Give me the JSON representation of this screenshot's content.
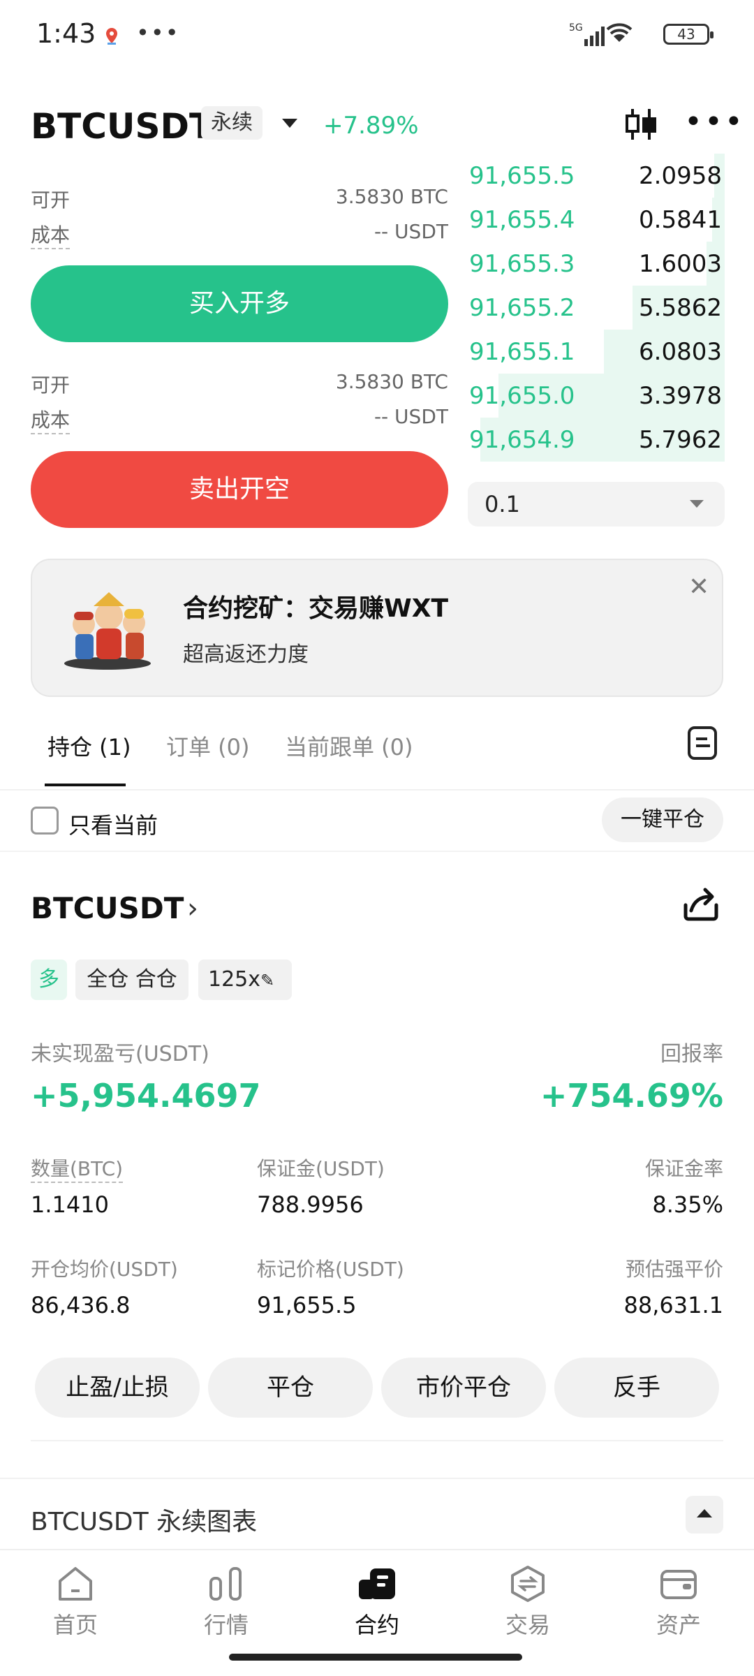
{
  "status_bar": {
    "time": "1:43",
    "network": "5G",
    "battery": "43"
  },
  "header": {
    "pair": "BTCUSDT",
    "contract_type": "永续",
    "change": "+7.89%"
  },
  "order_panel": {
    "buy_section": {
      "available_label": "可开",
      "available_value": "3.5830 BTC",
      "cost_label": "成本",
      "cost_value": "-- USDT",
      "button": "买入开多"
    },
    "sell_section": {
      "available_label": "可开",
      "available_value": "3.5830 BTC",
      "cost_label": "成本",
      "cost_value": "-- USDT",
      "button": "卖出开空"
    }
  },
  "order_book": {
    "rows": [
      {
        "price": "91,655.5",
        "qty": "2.0958",
        "depth": 0.04
      },
      {
        "price": "91,655.4",
        "qty": "0.5841",
        "depth": 0.05
      },
      {
        "price": "91,655.3",
        "qty": "1.6003",
        "depth": 0.07
      },
      {
        "price": "91,655.2",
        "qty": "5.5862",
        "depth": 0.36
      },
      {
        "price": "91,655.1",
        "qty": "6.0803",
        "depth": 0.47
      },
      {
        "price": "91,655.0",
        "qty": "3.3978",
        "depth": 0.88
      },
      {
        "price": "91,654.9",
        "qty": "5.7962",
        "depth": 0.95
      }
    ],
    "precision": "0.1"
  },
  "banner": {
    "title": "合约挖矿：交易赚WXT",
    "subtitle": "超高返还力度"
  },
  "tabs": [
    {
      "label": "持仓 (1)"
    },
    {
      "label": "订单 (0)"
    },
    {
      "label": "当前跟单 (0)"
    }
  ],
  "filter": {
    "only_current": "只看当前",
    "close_all": "一键平仓"
  },
  "position": {
    "pair": "BTCUSDT",
    "side": "多",
    "margin_mode": "全仓 合仓",
    "leverage": "125x",
    "pnl_label": "未实现盈亏(USDT)",
    "pnl_value": "+5,954.4697",
    "roe_label": "回报率",
    "roe_value": "+754.69%",
    "qty_label": "数量(BTC)",
    "qty_value": "1.1410",
    "margin_label": "保证金(USDT)",
    "margin_value": "788.9956",
    "margin_rate_label": "保证金率",
    "margin_rate_value": "8.35%",
    "entry_label": "开仓均价(USDT)",
    "entry_value": "86,436.8",
    "mark_label": "标记价格(USDT)",
    "mark_value": "91,655.5",
    "liq_label": "预估强平价",
    "liq_value": "88,631.1",
    "actions": [
      "止盈/止损",
      "平仓",
      "市价平仓",
      "反手"
    ]
  },
  "chart_section": {
    "title": "BTCUSDT 永续图表"
  },
  "nav": [
    {
      "label": "首页",
      "icon": "home-icon"
    },
    {
      "label": "行情",
      "icon": "market-icon"
    },
    {
      "label": "合约",
      "icon": "futures-icon"
    },
    {
      "label": "交易",
      "icon": "trade-icon"
    },
    {
      "label": "资产",
      "icon": "wallet-icon"
    }
  ],
  "colors": {
    "green": "#26c28b",
    "red": "#f04a42"
  }
}
